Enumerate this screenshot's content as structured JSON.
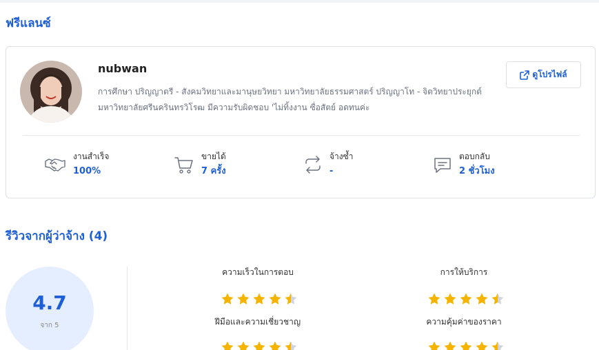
{
  "section_title": "ฟรีแลนซ์",
  "profile": {
    "username": "nubwan",
    "bio": "การศึกษา ปริญญาตรี - สังคมวิทยาและมานุษยวิทยา มหาวิทยาลัยธรรมศาสตร์ ปริญญาโท - จิตวิทยาประยุกต์ มหาวิทยาลัยศรีนครินทรวิโรฒ มีความรับผิดชอบ 'ไม่ทิ้งงาน ซื่อสัตย์ อดทนค่ะ",
    "view_profile_label": "ดูโปรไฟล์"
  },
  "stats": [
    {
      "label": "งานสำเร็จ",
      "value": "100%",
      "icon": "handshake-icon"
    },
    {
      "label": "ขายได้",
      "value": "7 ครั้ง",
      "icon": "cart-icon"
    },
    {
      "label": "จ้างซ้ำ",
      "value": "-",
      "icon": "repeat-icon"
    },
    {
      "label": "ตอบกลับ",
      "value": "2 ชั่วโมง",
      "icon": "chat-icon"
    }
  ],
  "reviews": {
    "title": "รีวิวจากผู้ว่าจ้าง (4)",
    "overall": "4.7",
    "overall_sub": "จาก 5",
    "criteria": [
      {
        "label": "ความเร็วในการตอบ",
        "rating": 4.5
      },
      {
        "label": "การให้บริการ",
        "rating": 4.5
      },
      {
        "label": "ฝีมือและความเชี่ยวชาญ",
        "rating": 4.5
      },
      {
        "label": "ความคุ้มค่าของราคา",
        "rating": 4.5
      }
    ]
  },
  "colors": {
    "accent": "#1f5fd6",
    "star": "#f4b400",
    "star_empty": "#d1d5db"
  }
}
